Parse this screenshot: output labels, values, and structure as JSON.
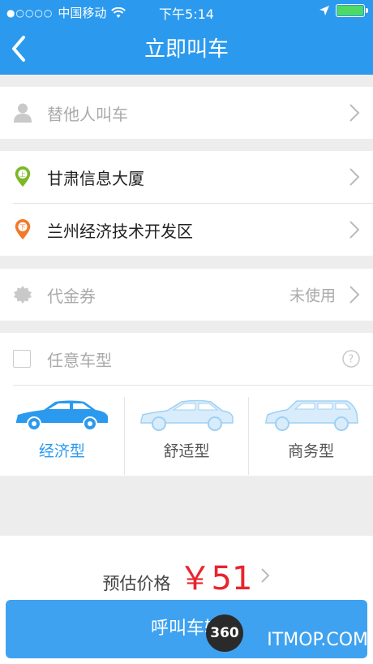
{
  "status": {
    "carrier": "中国移动",
    "time": "下午5:14"
  },
  "header": {
    "title": "立即叫车"
  },
  "passenger": {
    "label": "替他人叫车"
  },
  "route": {
    "pickup": "甘肃信息大厦",
    "dropoff": "兰州经济技术开发区"
  },
  "coupon": {
    "label": "代金券",
    "status": "未使用"
  },
  "car_type": {
    "any_label": "任意车型",
    "options": [
      {
        "label": "经济型",
        "selected": true
      },
      {
        "label": "舒适型",
        "selected": false
      },
      {
        "label": "商务型",
        "selected": false
      }
    ]
  },
  "price": {
    "label": "预估价格",
    "value": "￥51"
  },
  "call_button": {
    "label": "呼叫车辆"
  },
  "watermark": {
    "badge": "360",
    "site": "ITMOP.COM"
  },
  "colors": {
    "primary": "#2b9aee",
    "price": "#e8242e",
    "pickup": "#7cb826",
    "dropoff": "#f07b2a"
  }
}
